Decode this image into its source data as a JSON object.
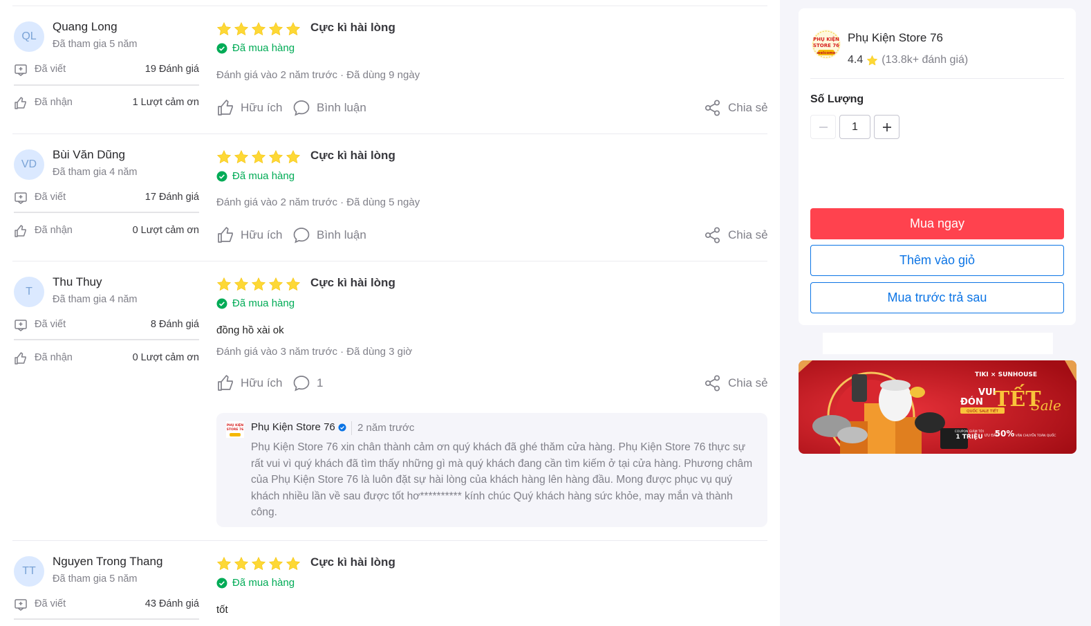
{
  "reviews": [
    {
      "initials": "QL",
      "name": "Quang Long",
      "joined": "Đã tham gia 5 năm",
      "written_label": "Đã viết",
      "written_value": "19 Đánh giá",
      "thanks_label": "Đã nhận",
      "thanks_value": "1 Lượt cảm ơn",
      "rating": 5,
      "title": "Cực kì hài lòng",
      "bought": "Đã mua hàng",
      "text": "",
      "meta": "Đánh giá vào 2 năm trước · Đã dùng 9 ngày",
      "helpful": "Hữu ích",
      "comment": "Bình luận",
      "share": "Chia sẻ"
    },
    {
      "initials": "VD",
      "name": "Bùi Văn Dũng",
      "joined": "Đã tham gia 4 năm",
      "written_label": "Đã viết",
      "written_value": "17 Đánh giá",
      "thanks_label": "Đã nhận",
      "thanks_value": "0 Lượt cảm ơn",
      "rating": 5,
      "title": "Cực kì hài lòng",
      "bought": "Đã mua hàng",
      "text": "",
      "meta": "Đánh giá vào 2 năm trước · Đã dùng 5 ngày",
      "helpful": "Hữu ích",
      "comment": "Bình luận",
      "share": "Chia sẻ"
    },
    {
      "initials": "T",
      "name": "Thu Thuy",
      "joined": "Đã tham gia 4 năm",
      "written_label": "Đã viết",
      "written_value": "8 Đánh giá",
      "thanks_label": "Đã nhận",
      "thanks_value": "0 Lượt cảm ơn",
      "rating": 5,
      "title": "Cực kì hài lòng",
      "bought": "Đã mua hàng",
      "text": "đồng hồ xài ok",
      "meta": "Đánh giá vào 3 năm trước · Đã dùng 3 giờ",
      "helpful": "Hữu ích",
      "comment": "1",
      "share": "Chia sẻ",
      "reply": {
        "shop": "Phụ Kiện Store 76",
        "time": "2 năm trước",
        "body": "Phụ Kiện Store 76 xin chân thành cảm ơn quý khách đã ghé thăm cửa hàng. Phụ Kiện Store 76 thực sự rất vui vì quý khách đã tìm thấy những gì mà quý khách đang cần tìm kiếm ở tại cửa hàng. Phương châm của Phụ Kiện Store 76 là luôn đặt sự hài lòng của khách hàng lên hàng đầu. Mong được phục vụ quý khách nhiều lần về sau được tốt hơ********** kính chúc Quý khách hàng sức khỏe, may mắn và thành công."
      }
    },
    {
      "initials": "TT",
      "name": "Nguyen Trong Thang",
      "joined": "Đã tham gia 5 năm",
      "written_label": "Đã viết",
      "written_value": "43 Đánh giá",
      "rating": 5,
      "title": "Cực kì hài lòng",
      "bought": "Đã mua hàng",
      "text": "tốt"
    }
  ],
  "sidebar": {
    "shop_name": "Phụ Kiện Store 76",
    "logo_text_1": "PHỤ KIỆN",
    "logo_text_2": "STORE 76",
    "logo_text_3": "welcome",
    "rating": "4.4",
    "rating_count": "(13.8k+ đánh giá)",
    "qty_label": "Số Lượng",
    "qty_value": "1",
    "buy_now": "Mua ngay",
    "add_to_cart": "Thêm vào giỏ",
    "pay_later": "Mua trước trả sau"
  },
  "banner": {
    "brand": "TIKI × SUNHOUSE",
    "vui": "VUI",
    "don": "ĐÓN",
    "tet": "TẾT",
    "sale": "Sale",
    "tag": "QUỐC SALE TIẾT",
    "offer1_big": "1 TRIỆU",
    "offer1_small": "COUPON GIẢM TỚI",
    "offer2_big": "50%",
    "offer2_small": "ƯU ĐÃI",
    "offer3_small": "VẬN CHUYỂN TOÀN QUỐC"
  },
  "colors": {
    "star": "#fdd836",
    "bought": "#00ab56",
    "primary": "#ff424e",
    "link": "#0b74e5"
  }
}
